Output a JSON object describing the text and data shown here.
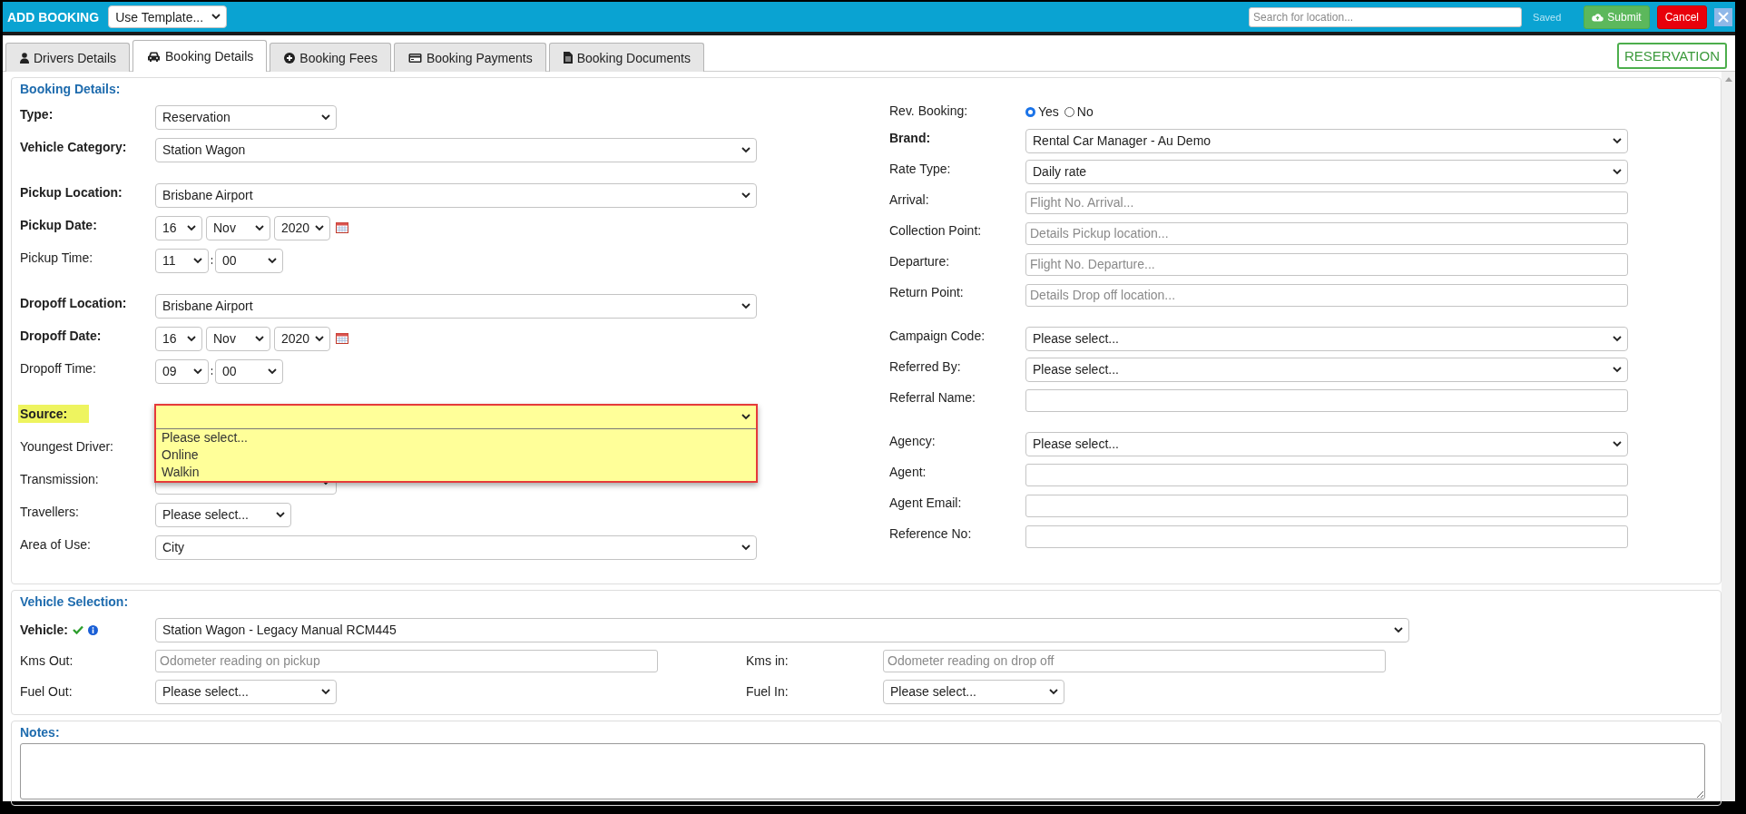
{
  "header": {
    "title": "ADD BOOKING",
    "template_select": "Use Template...",
    "search": {
      "placeholder": "Search for location..."
    },
    "saved": "Saved",
    "buttons": [
      {
        "kind": "submit",
        "label": "Submit"
      },
      {
        "kind": "cancel",
        "label": "Cancel"
      },
      {
        "kind": "close"
      }
    ]
  },
  "tabs": [
    {
      "kind": "drivers",
      "label": "Drivers Details",
      "selected": false
    },
    {
      "kind": "booking",
      "label": "Booking Details",
      "selected": true
    },
    {
      "kind": "fees",
      "label": "Booking Fees",
      "selected": false
    },
    {
      "kind": "payments",
      "label": "Booking Payments",
      "selected": false
    },
    {
      "kind": "documents",
      "label": "Booking Documents",
      "selected": false
    }
  ],
  "status_badge": "RESERVATION",
  "booking_details": {
    "title": "Booking Details:",
    "left_groups": [
      [
        {
          "label": "Type:",
          "bold": true,
          "highlighted": false,
          "kind": "select_short",
          "value": "Reservation"
        },
        {
          "label": "Vehicle Category:",
          "bold": true,
          "highlighted": false,
          "kind": "select",
          "value": "Station Wagon"
        }
      ],
      [
        {
          "label": "Pickup Location:",
          "bold": true,
          "highlighted": false,
          "kind": "select",
          "value": "Brisbane Airport"
        },
        {
          "label": "Pickup Date:",
          "bold": true,
          "highlighted": false,
          "kind": "date",
          "day": "16",
          "month": "Nov",
          "year": "2020"
        },
        {
          "label": "Pickup Time:",
          "bold": false,
          "highlighted": false,
          "kind": "time",
          "hour": "11",
          "minute": "00"
        }
      ],
      [
        {
          "label": "Dropoff Location:",
          "bold": true,
          "highlighted": false,
          "kind": "select",
          "value": "Brisbane Airport"
        },
        {
          "label": "Dropoff Date:",
          "bold": true,
          "highlighted": false,
          "kind": "date",
          "day": "16",
          "month": "Nov",
          "year": "2020"
        },
        {
          "label": "Dropoff Time:",
          "bold": false,
          "highlighted": false,
          "kind": "time",
          "hour": "09",
          "minute": "00"
        }
      ],
      [
        {
          "label": "Source:",
          "bold": true,
          "highlighted": true,
          "kind": "dropdown_open",
          "options": [
            {
              "label": "Please select...",
              "selected": false
            },
            {
              "label": "Online",
              "selected": false
            },
            {
              "label": "Walkin",
              "selected": false
            }
          ]
        },
        {
          "label": "Youngest Driver:",
          "bold": false,
          "highlighted": false,
          "kind": "hidden"
        },
        {
          "label": "Transmission:",
          "bold": false,
          "highlighted": false,
          "kind": "select_short"
        },
        {
          "label": "Travellers:",
          "bold": false,
          "highlighted": false,
          "kind": "select_mini",
          "value": "Please select..."
        },
        {
          "label": "Area of Use:",
          "bold": false,
          "highlighted": false,
          "kind": "select",
          "value": "City"
        }
      ]
    ],
    "right_groups": [
      [
        {
          "label": "Rev. Booking:",
          "bold": false,
          "kind": "radio",
          "options": [
            {
              "label": "Yes",
              "selected": true
            },
            {
              "label": "No",
              "selected": false
            }
          ]
        },
        {
          "label": "Brand:",
          "bold": true,
          "kind": "select",
          "value": "Rental Car Manager - Au Demo"
        },
        {
          "label": "Rate Type:",
          "bold": false,
          "kind": "select",
          "value": "Daily rate"
        },
        {
          "label": "Arrival:",
          "bold": false,
          "kind": "input",
          "placeholder": "Flight No. Arrival..."
        },
        {
          "label": "Collection Point:",
          "bold": false,
          "kind": "input",
          "placeholder": "Details Pickup location..."
        },
        {
          "label": "Departure:",
          "bold": false,
          "kind": "input",
          "placeholder": "Flight No. Departure..."
        },
        {
          "label": "Return Point:",
          "bold": false,
          "kind": "input",
          "placeholder": "Details Drop off location..."
        }
      ],
      [
        {
          "label": "Campaign Code:",
          "bold": false,
          "kind": "select",
          "value": "Please select..."
        },
        {
          "label": "Referred By:",
          "bold": false,
          "kind": "select",
          "value": "Please select..."
        },
        {
          "label": "Referral Name:",
          "bold": false,
          "kind": "input"
        }
      ],
      [
        {
          "label": "Agency:",
          "bold": false,
          "kind": "select",
          "value": "Please select..."
        },
        {
          "label": "Agent:",
          "bold": false,
          "kind": "input"
        },
        {
          "label": "Agent Email:",
          "bold": false,
          "kind": "input"
        },
        {
          "label": "Reference No:",
          "bold": false,
          "kind": "input"
        }
      ]
    ]
  },
  "vehicle_selection": {
    "title": "Vehicle Selection:",
    "vehicle": {
      "label": "Vehicle:",
      "verified": true,
      "value": "Station Wagon - Legacy Manual RCM445"
    },
    "rows": [
      [
        {
          "label": "Kms Out:",
          "kind": "input",
          "placeholder": "Odometer reading on pickup"
        },
        {
          "label": "Kms in:",
          "kind": "input",
          "placeholder": "Odometer reading on drop off"
        }
      ],
      [
        {
          "label": "Fuel Out:",
          "kind": "select_short",
          "value": "Please select..."
        },
        {
          "label": "Fuel In:",
          "kind": "select_short",
          "value": "Please select..."
        }
      ]
    ]
  },
  "notes": {
    "title": "Notes:"
  }
}
